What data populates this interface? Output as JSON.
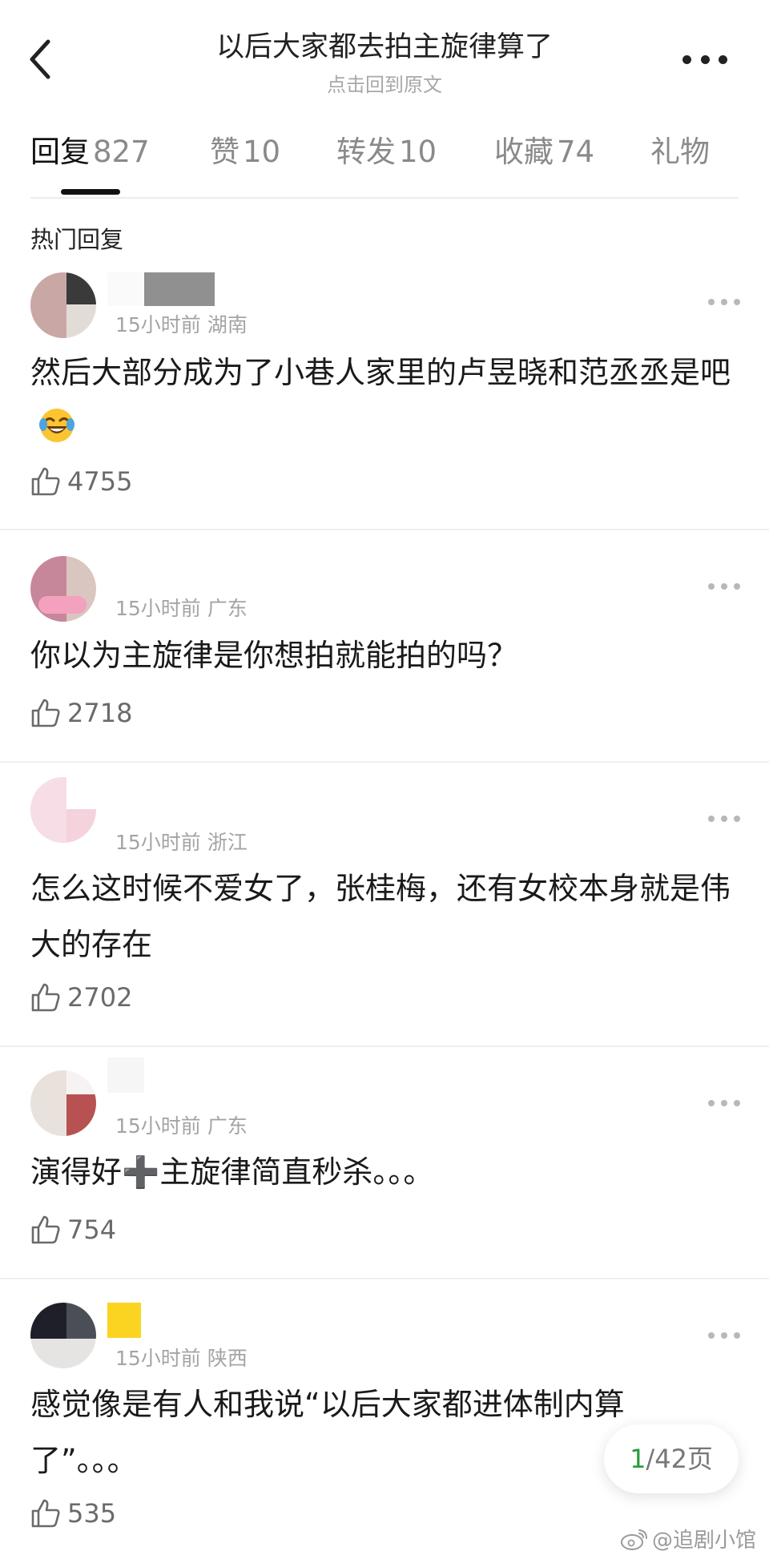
{
  "header": {
    "title": "以后大家都去拍主旋律算了",
    "subtitle": "点击回到原文"
  },
  "tabs": [
    {
      "label": "回复",
      "count": "827",
      "active": true
    },
    {
      "label": "赞",
      "count": "10",
      "active": false
    },
    {
      "label": "转发",
      "count": "10",
      "active": false
    },
    {
      "label": "收藏",
      "count": "74",
      "active": false
    },
    {
      "label": "礼物",
      "count": "",
      "active": false
    }
  ],
  "section_title": "热门回复",
  "comments": [
    {
      "time": "15小时前",
      "location": "湖南",
      "text": "然后大部分成为了小巷人家里的卢昱晓和范丞丞是吧",
      "emoji": "laughing-crying-emoji",
      "likes": "4755"
    },
    {
      "time": "15小时前",
      "location": "广东",
      "text": "你以为主旋律是你想拍就能拍的吗？",
      "likes": "2718"
    },
    {
      "time": "15小时前",
      "location": "浙江",
      "text": "怎么这时候不爱女了，张桂梅，还有女校本身就是伟大的存在",
      "likes": "2702"
    },
    {
      "time": "15小时前",
      "location": "广东",
      "text": "演得好➕主旋律简直秒杀。。。",
      "likes": "754"
    },
    {
      "time": "15小时前",
      "location": "陕西",
      "text": "感觉像是有人和我说“以后大家都进体制内算了”。。。",
      "likes": "535"
    }
  ],
  "pagination": {
    "current": "1",
    "total": "/42页"
  },
  "watermark": "@追剧小馆",
  "icons": {
    "back": "chevron-left-icon",
    "more": "more-dots-icon",
    "like": "thumbs-up-icon",
    "weibo": "weibo-logo-icon"
  },
  "colors": {
    "page_accent": "#2b9a3b",
    "text_primary": "#1a1a1a",
    "text_secondary": "#a4a4a4"
  }
}
